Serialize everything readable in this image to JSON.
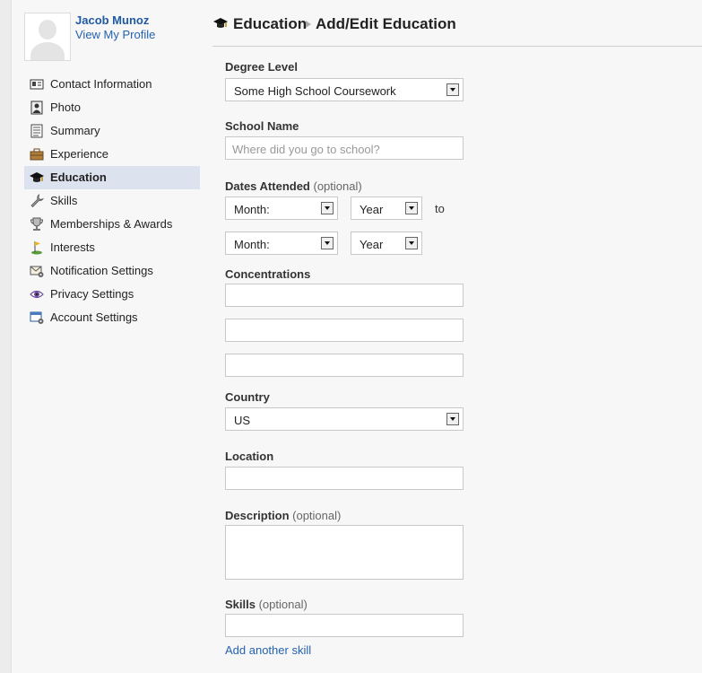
{
  "profile": {
    "name": "Jacob Munoz",
    "link": "View My Profile"
  },
  "nav": [
    {
      "label": "Contact Information",
      "icon": "contact-card-icon"
    },
    {
      "label": "Photo",
      "icon": "photo-icon"
    },
    {
      "label": "Summary",
      "icon": "summary-icon"
    },
    {
      "label": "Experience",
      "icon": "briefcase-icon"
    },
    {
      "label": "Education",
      "icon": "graduation-cap-icon",
      "active": true
    },
    {
      "label": "Skills",
      "icon": "wrench-icon"
    },
    {
      "label": "Memberships & Awards",
      "icon": "trophy-icon"
    },
    {
      "label": "Interests",
      "icon": "golf-flag-icon"
    },
    {
      "label": "Notification Settings",
      "icon": "envelope-gear-icon"
    },
    {
      "label": "Privacy Settings",
      "icon": "eye-icon"
    },
    {
      "label": "Account Settings",
      "icon": "window-gear-icon"
    }
  ],
  "header": {
    "section": "Education",
    "page": "Add/Edit Education"
  },
  "form": {
    "degree": {
      "label": "Degree Level",
      "value": "Some High School Coursework"
    },
    "school": {
      "label": "School Name",
      "placeholder": "Where did you go to school?"
    },
    "dates": {
      "label": "Dates Attended",
      "optional": "(optional)",
      "start_month": "Month:",
      "start_year": "Year",
      "to": "to",
      "end_month": "Month:",
      "end_year": "Year"
    },
    "concentrations": {
      "label": "Concentrations"
    },
    "country": {
      "label": "Country",
      "value": "US"
    },
    "location": {
      "label": "Location"
    },
    "description": {
      "label": "Description",
      "optional": "(optional)"
    },
    "skills": {
      "label": "Skills",
      "optional": "(optional)",
      "add_link": "Add another skill"
    }
  }
}
